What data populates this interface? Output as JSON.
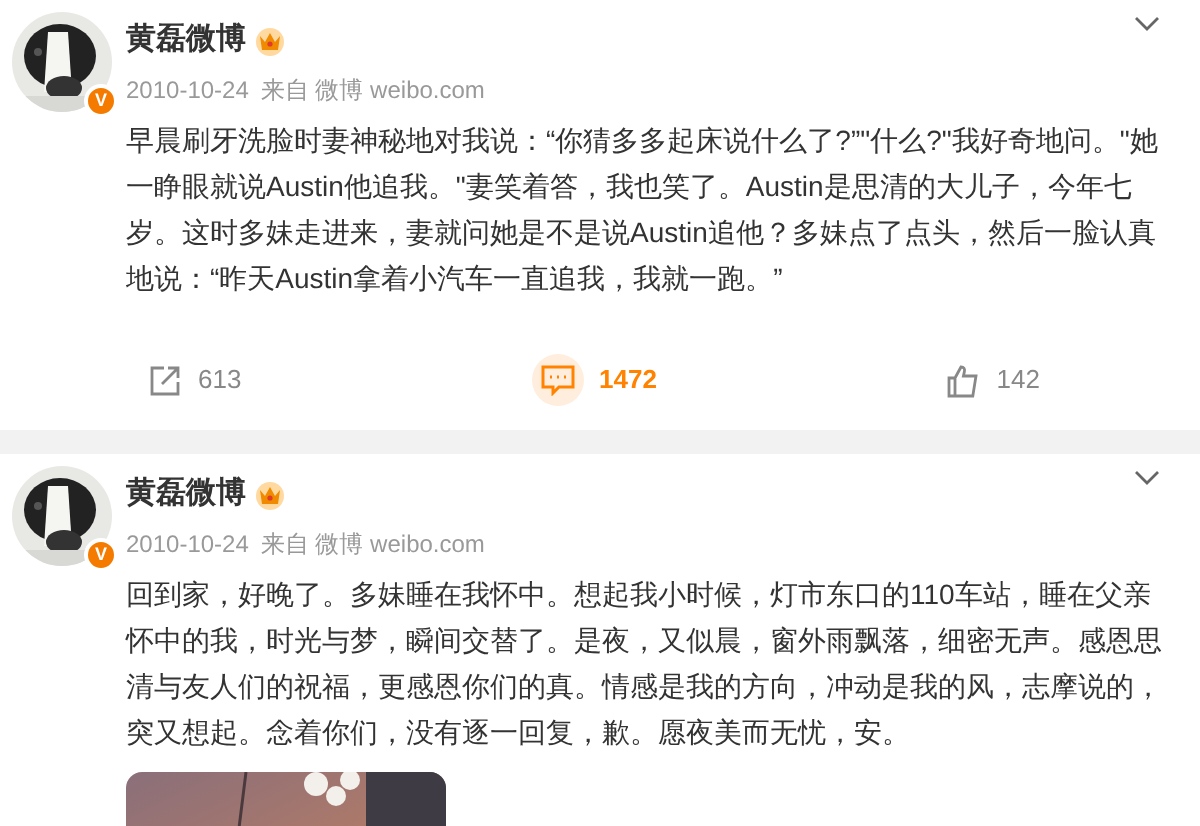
{
  "posts": [
    {
      "author": "黄磊微博",
      "verified_badge": "V",
      "date": "2010-10-24",
      "source": "来自 微博 weibo.com",
      "text": "早晨刷牙洗脸时妻神秘地对我说：“你猜多多起床说什么了?”\"什么?\"我好奇地问。\"她一睁眼就说Austin他追我。\"妻笑着答，我也笑了。Austin是思清的大儿子，今年七岁。这时多妹走进来，妻就问她是不是说Austin追他？多妹点了点头，然后一脸认真地说：“昨天Austin拿着小汽车一直追我，我就一跑。”",
      "actions": [
        {
          "kind": "repost",
          "count": "613",
          "active": false
        },
        {
          "kind": "comment",
          "count": "1472",
          "active": true
        },
        {
          "kind": "like",
          "count": "142",
          "active": false
        }
      ]
    },
    {
      "author": "黄磊微博",
      "verified_badge": "V",
      "date": "2010-10-24",
      "source": "来自 微博 weibo.com",
      "text": "回到家，好晚了。多妹睡在我怀中。想起我小时候，灯市东口的110车站，睡在父亲怀中的我，时光与梦，瞬间交替了。是夜，又似晨，窗外雨飘落，细密无声。感恩思清与友人们的祝福，更感恩你们的真。情感是我的方向，冲动是我的风，志摩说的，突又想起。念着你们，没有逐一回复，歉。愿夜美而无忧，安。"
    }
  ]
}
